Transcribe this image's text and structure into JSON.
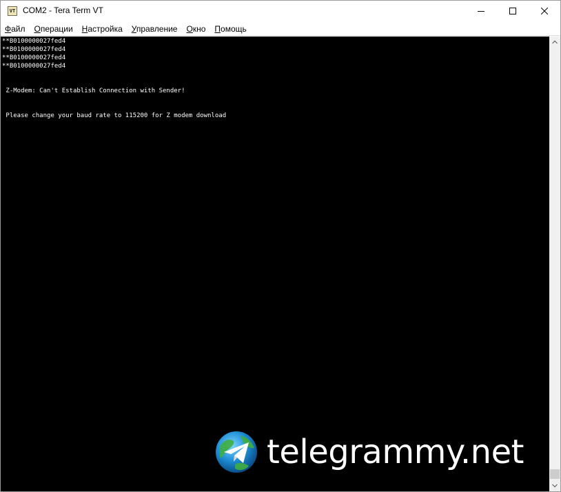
{
  "window": {
    "title": "COM2 - Tera Term VT",
    "icon_label": "VT"
  },
  "menu": {
    "items": [
      {
        "accel": "Ф",
        "rest": "айл"
      },
      {
        "accel": "О",
        "rest": "перации"
      },
      {
        "accel": "Н",
        "rest": "астройка"
      },
      {
        "accel": "У",
        "rest": "правление"
      },
      {
        "accel": "О",
        "rest": "кно"
      },
      {
        "accel": "П",
        "rest": "омощь"
      }
    ]
  },
  "terminal": {
    "lines": [
      "**B0100000027fed4",
      "**B0100000027fed4",
      "**B0100000027fed4",
      "**B0100000027fed4",
      "",
      "",
      " Z-Modem: Can't Establish Connection with Sender!",
      "",
      "",
      " Please change your baud rate to 115200 for Z modem download"
    ]
  },
  "watermark": {
    "text": "telegrammy.net"
  },
  "colors": {
    "terminal_bg": "#000000",
    "terminal_fg": "#ffffff",
    "window_chrome": "#ffffff"
  },
  "icons": {
    "minimize": "minimize-icon",
    "maximize": "maximize-icon",
    "close": "close-icon",
    "scroll_up": "chevron-up-icon",
    "scroll_down": "chevron-down-icon",
    "logo": "telegram-globe-icon"
  }
}
